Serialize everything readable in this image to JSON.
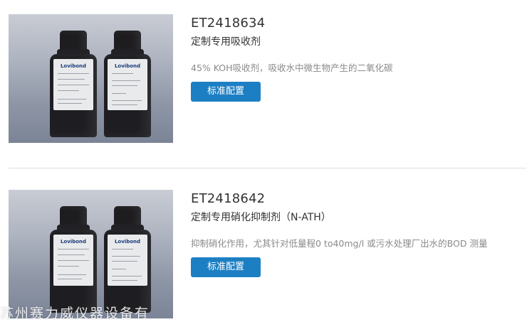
{
  "products": [
    {
      "sku": "ET2418634",
      "name": "定制专用吸收剂",
      "description": "45% KOH吸收剂，吸收水中微生物产生的二氧化碳",
      "button_label": "标准配置",
      "image": {
        "bottle_left": {
          "brand": "Lovibond"
        },
        "bottle_right": {
          "brand": "Lovibond"
        }
      }
    },
    {
      "sku": "ET2418642",
      "name": "定制专用硝化抑制剂（N-ATH）",
      "description": "抑制硝化作用，尤其针对低量程0 to40mg/l 或污水处理厂出水的BOD 测量",
      "button_label": "标准配置",
      "image": {
        "bottle_left": {
          "brand": "Lovibond"
        },
        "bottle_right": {
          "brand": "Lovibond"
        }
      }
    }
  ],
  "watermark": "苏州赛力威仪器设备有",
  "colors": {
    "button_bg": "#1d7fc3",
    "sku_text": "#333333",
    "desc_text": "#8a8a8a",
    "divider": "#e0e0e0"
  }
}
